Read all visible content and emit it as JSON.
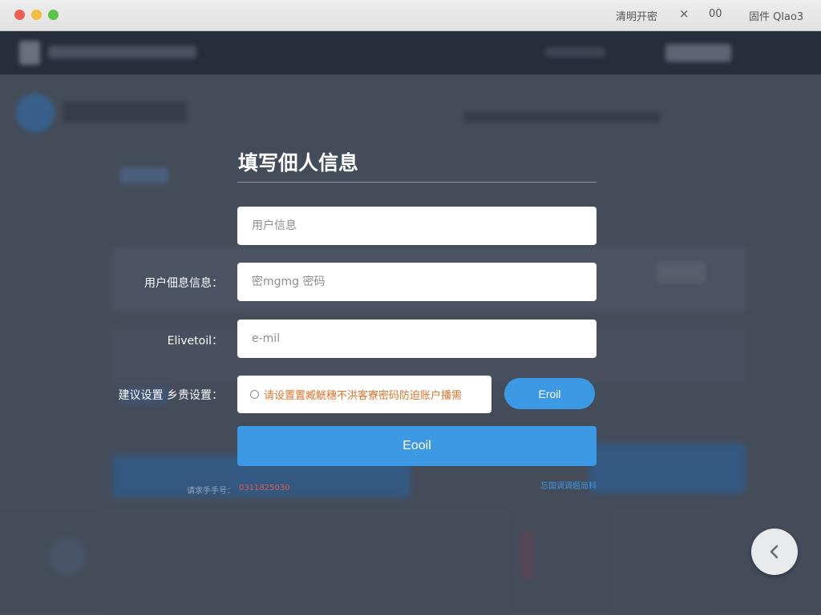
{
  "titlebar": {
    "tab_label": "清明开密",
    "close_glyph": "×",
    "counter": "00",
    "user_label": "固件 Qlao3"
  },
  "form": {
    "title": "填写佃人信息",
    "username_placeholder": "用户信息",
    "password_label": "用户佃息信息：",
    "password_placeholder": "密mgmg 密码",
    "email_label": "Elivetoil：",
    "email_placeholder": "e-mil",
    "security_label": "建议设置 乡贵设置：",
    "security_hint": "请设置置臧觥穗不洪客寮密码防迫账户播需",
    "send_button": "Eroil",
    "submit_button": "Eooil",
    "footer_left_prefix": "请求手手号：",
    "footer_left_value": "0311825030",
    "footer_right_link": "忘国调调题局科"
  },
  "colors": {
    "accent": "#3d99e4",
    "warning": "#e0742d"
  }
}
